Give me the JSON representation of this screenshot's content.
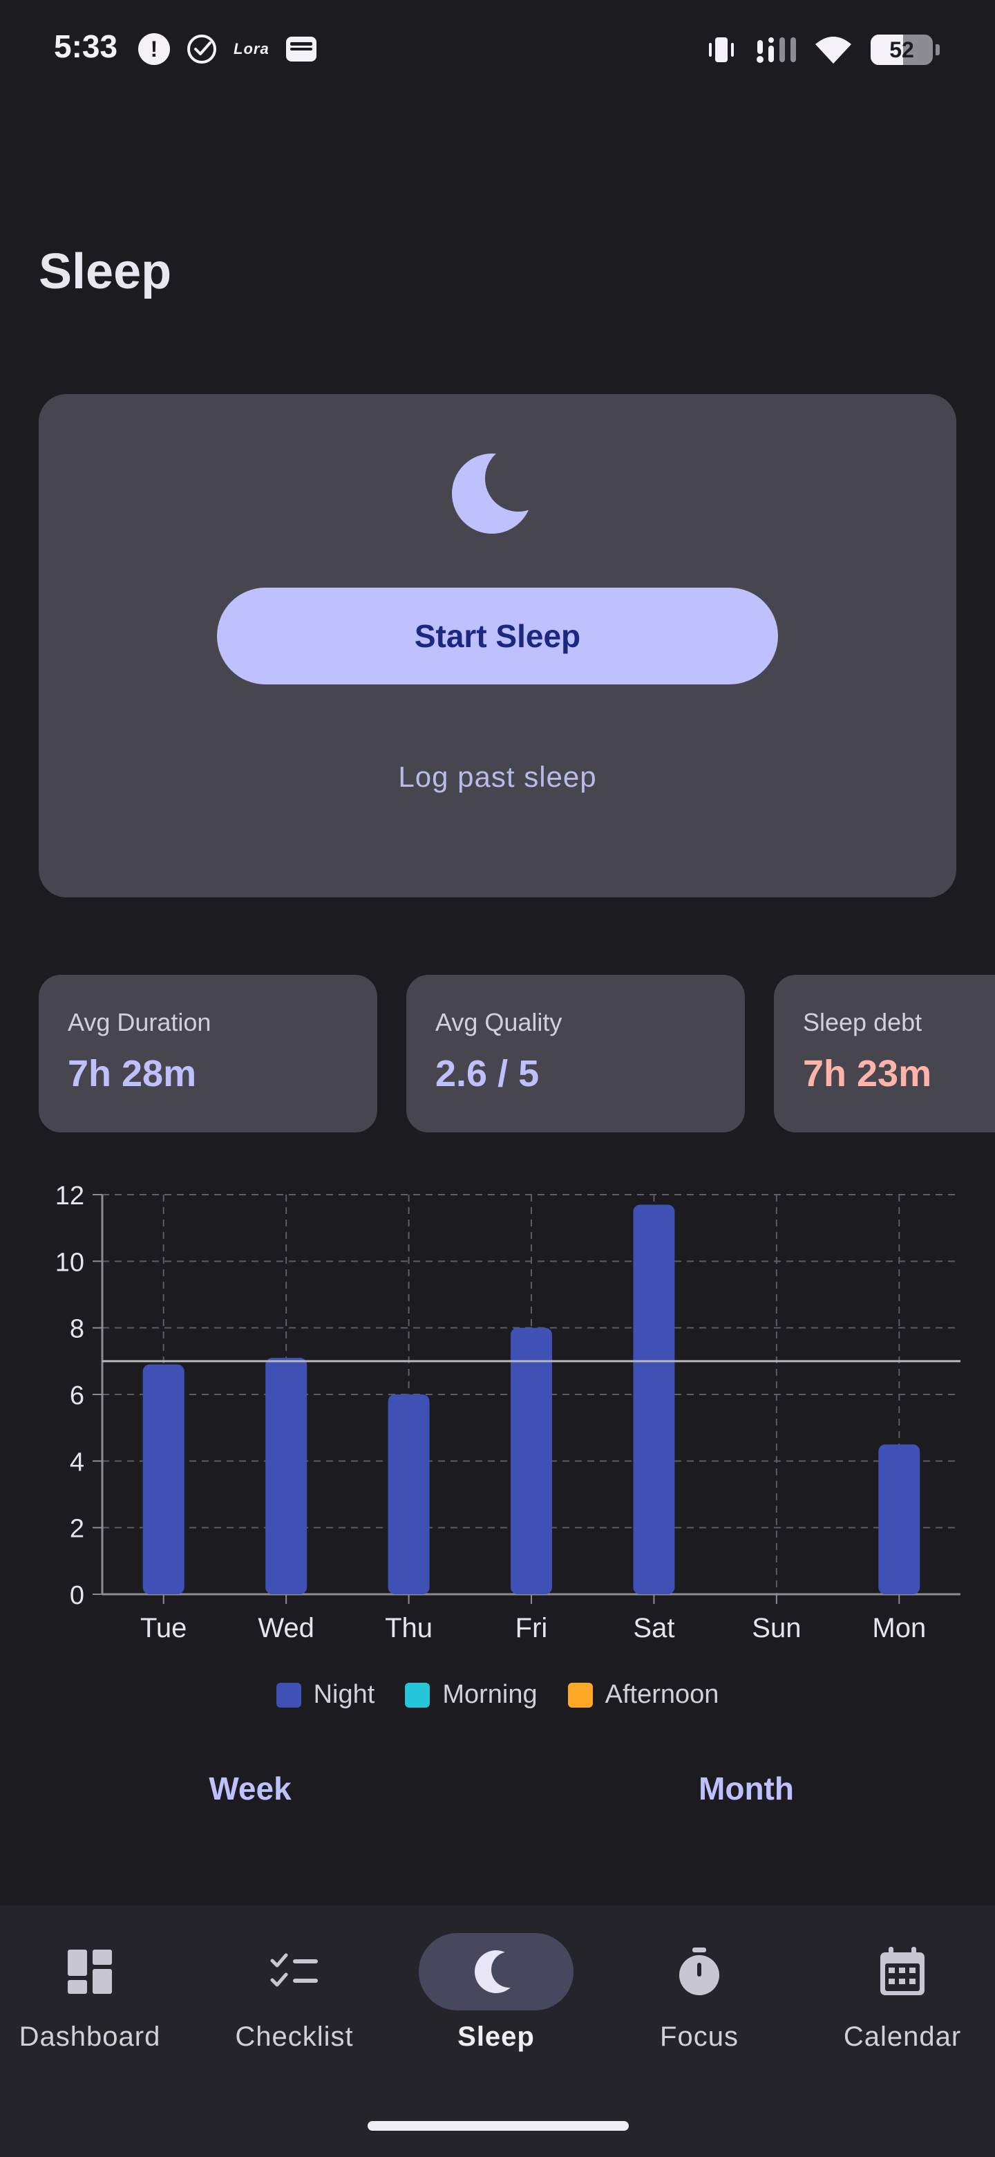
{
  "status_bar": {
    "time": "5:33",
    "left_icons": [
      "alert-icon",
      "check-circle-icon",
      "lora-icon",
      "wallet-icon"
    ],
    "lora_text": "Lora",
    "alert_glyph": "!",
    "right_icons": [
      "vibrate-icon",
      "signal-icon",
      "wifi-icon",
      "battery-icon"
    ],
    "battery_level": "52"
  },
  "page": {
    "title": "Sleep"
  },
  "hero": {
    "icon": "moon-icon",
    "start_label": "Start Sleep",
    "log_label": "Log past sleep",
    "colors": {
      "card": "#47464f",
      "button": "#bfc1ff",
      "button_text": "#1c2780",
      "moon": "#bfc1ff"
    }
  },
  "stats": [
    {
      "label": "Avg Duration",
      "value": "7h 28m"
    },
    {
      "label": "Avg Quality",
      "value": "2.6 / 5"
    },
    {
      "label": "Sleep debt",
      "value": "7h 23m"
    }
  ],
  "chart_data": {
    "type": "bar",
    "categories": [
      "Tue",
      "Wed",
      "Thu",
      "Fri",
      "Sat",
      "Sun",
      "Mon"
    ],
    "series": [
      {
        "name": "Night",
        "color": "#3f51b5",
        "values": [
          6.9,
          7.1,
          6.0,
          8.0,
          11.7,
          0,
          4.5
        ]
      },
      {
        "name": "Morning",
        "color": "#26c6da",
        "values": [
          0,
          0,
          0,
          0,
          0,
          0,
          0
        ]
      },
      {
        "name": "Afternoon",
        "color": "#ffa726",
        "values": [
          0,
          0,
          0,
          0,
          0,
          0,
          0
        ]
      }
    ],
    "stacked": true,
    "y_ticks": [
      "0",
      "2",
      "4",
      "6",
      "8",
      "10",
      "12"
    ],
    "ylim": [
      0,
      12
    ],
    "reference_line": 7,
    "grid": true,
    "legend_position": "bottom"
  },
  "range_tabs": [
    "Week",
    "Month"
  ],
  "nav": {
    "items": [
      {
        "label": "Dashboard",
        "icon": "dashboard-icon",
        "active": false
      },
      {
        "label": "Checklist",
        "icon": "checklist-icon",
        "active": false
      },
      {
        "label": "Sleep",
        "icon": "moon-icon",
        "active": true
      },
      {
        "label": "Focus",
        "icon": "timer-icon",
        "active": false
      },
      {
        "label": "Calendar",
        "icon": "calendar-icon",
        "active": false
      }
    ]
  }
}
